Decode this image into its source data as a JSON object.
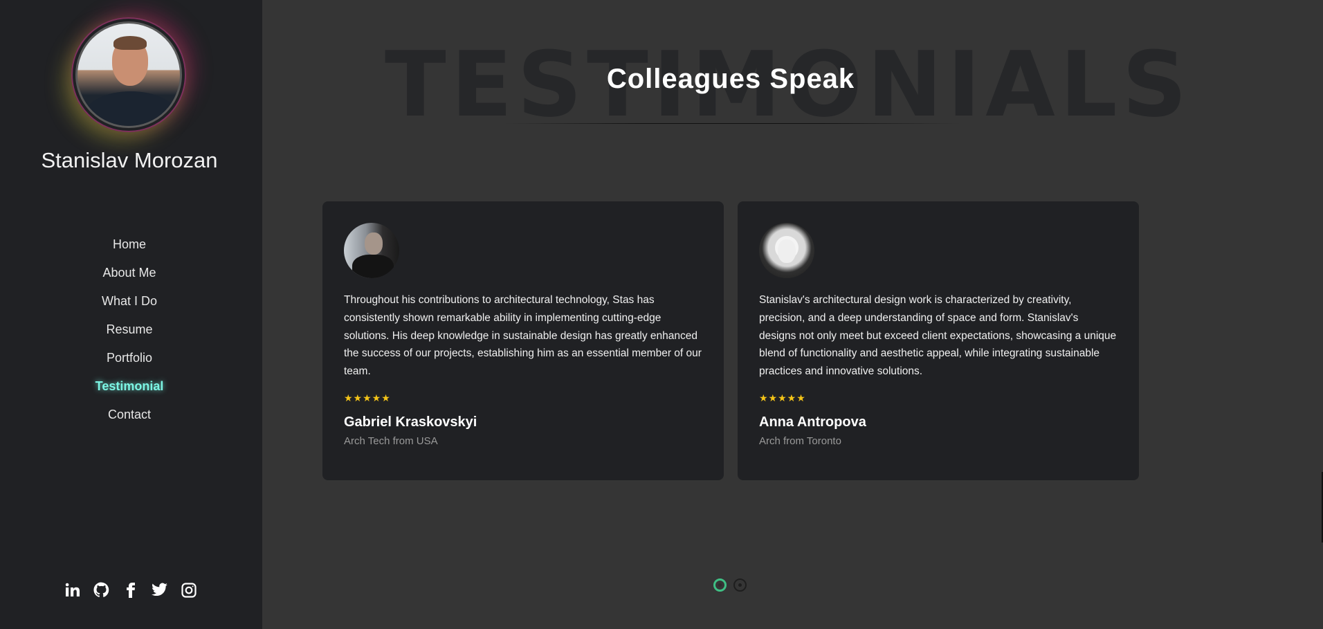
{
  "sidebar": {
    "name": "Stanislav Morozan",
    "nav": [
      {
        "label": "Home",
        "active": false
      },
      {
        "label": "About Me",
        "active": false
      },
      {
        "label": "What I Do",
        "active": false
      },
      {
        "label": "Resume",
        "active": false
      },
      {
        "label": "Portfolio",
        "active": false
      },
      {
        "label": "Testimonial",
        "active": true
      },
      {
        "label": "Contact",
        "active": false
      }
    ],
    "social": [
      "linkedin-icon",
      "github-icon",
      "facebook-icon",
      "twitter-icon",
      "instagram-icon"
    ]
  },
  "section": {
    "background_title": "TESTIMONIALS",
    "title": "Colleagues Speak"
  },
  "testimonials": [
    {
      "quote": "Throughout his contributions to architectural technology, Stas has consistently shown remarkable ability in implementing cutting-edge solutions. His deep knowledge in sustainable design has greatly enhanced the success of our projects, establishing him as an essential member of our team.",
      "rating": 5,
      "stars": "★★★★★",
      "name": "Gabriel Kraskovskyi",
      "role": "Arch Tech from USA"
    },
    {
      "quote": "Stanislav's architectural design work is characterized by creativity, precision, and a deep understanding of space and form. Stanislav's designs not only meet but exceed client expectations, showcasing a unique blend of functionality and aesthetic appeal, while integrating sustainable practices and innovative solutions.",
      "rating": 5,
      "stars": "★★★★★",
      "name": "Anna Antropova",
      "role": "Arch from Toronto"
    }
  ],
  "carousel": {
    "pages": 2,
    "current": 1
  },
  "colors": {
    "accent": "#7cf5e4",
    "star": "#f5c518",
    "dot_active": "#3fbf84",
    "sidebar_bg": "#202124",
    "page_bg": "#353535"
  }
}
